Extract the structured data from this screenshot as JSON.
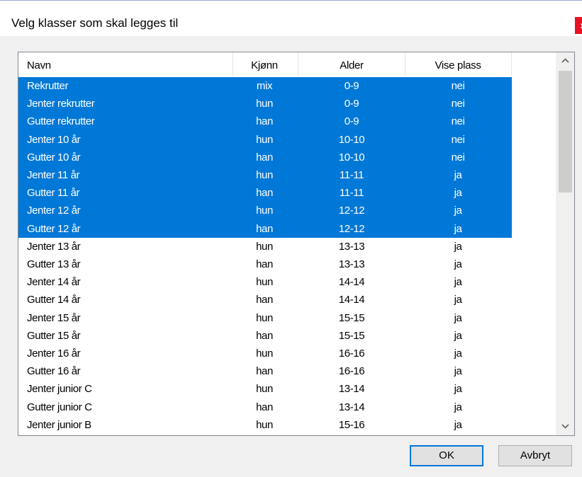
{
  "dialog": {
    "title": "Velg klasser som skal legges til",
    "close_glyph": "x",
    "colors": {
      "selection": "#0078d7",
      "close": "#e81123",
      "default_border": "#0078d7"
    }
  },
  "list": {
    "columns": [
      "Navn",
      "Kjønn",
      "Alder",
      "Vise plass"
    ],
    "rows": [
      {
        "name": "Rekrutter",
        "gender": "mix",
        "age": "0-9",
        "show": "nei",
        "selected": true
      },
      {
        "name": "Jenter rekrutter",
        "gender": "hun",
        "age": "0-9",
        "show": "nei",
        "selected": true
      },
      {
        "name": "Gutter rekrutter",
        "gender": "han",
        "age": "0-9",
        "show": "nei",
        "selected": true
      },
      {
        "name": "Jenter 10 år",
        "gender": "hun",
        "age": "10-10",
        "show": "nei",
        "selected": true
      },
      {
        "name": "Gutter 10 år",
        "gender": "han",
        "age": "10-10",
        "show": "nei",
        "selected": true
      },
      {
        "name": "Jenter 11 år",
        "gender": "hun",
        "age": "11-11",
        "show": "ja",
        "selected": true
      },
      {
        "name": "Gutter 11 år",
        "gender": "han",
        "age": "11-11",
        "show": "ja",
        "selected": true
      },
      {
        "name": "Jenter 12 år",
        "gender": "hun",
        "age": "12-12",
        "show": "ja",
        "selected": true
      },
      {
        "name": "Gutter 12 år",
        "gender": "han",
        "age": "12-12",
        "show": "ja",
        "selected": true
      },
      {
        "name": "Jenter 13 år",
        "gender": "hun",
        "age": "13-13",
        "show": "ja",
        "selected": false
      },
      {
        "name": "Gutter 13 år",
        "gender": "han",
        "age": "13-13",
        "show": "ja",
        "selected": false
      },
      {
        "name": "Jenter 14 år",
        "gender": "hun",
        "age": "14-14",
        "show": "ja",
        "selected": false
      },
      {
        "name": "Gutter 14 år",
        "gender": "han",
        "age": "14-14",
        "show": "ja",
        "selected": false
      },
      {
        "name": "Jenter 15 år",
        "gender": "hun",
        "age": "15-15",
        "show": "ja",
        "selected": false
      },
      {
        "name": "Gutter 15 år",
        "gender": "han",
        "age": "15-15",
        "show": "ja",
        "selected": false
      },
      {
        "name": "Jenter 16 år",
        "gender": "hun",
        "age": "16-16",
        "show": "ja",
        "selected": false
      },
      {
        "name": "Gutter 16 år",
        "gender": "han",
        "age": "16-16",
        "show": "ja",
        "selected": false
      },
      {
        "name": "Jenter junior C",
        "gender": "hun",
        "age": "13-14",
        "show": "ja",
        "selected": false
      },
      {
        "name": "Gutter junior C",
        "gender": "han",
        "age": "13-14",
        "show": "ja",
        "selected": false
      },
      {
        "name": "Jenter junior B",
        "gender": "hun",
        "age": "15-16",
        "show": "ja",
        "selected": false
      }
    ],
    "scrollbar": {
      "up_icon": "chevron-up-icon",
      "down_icon": "chevron-down-icon"
    }
  },
  "buttons": {
    "ok_label": "OK",
    "cancel_label": "Avbryt"
  }
}
